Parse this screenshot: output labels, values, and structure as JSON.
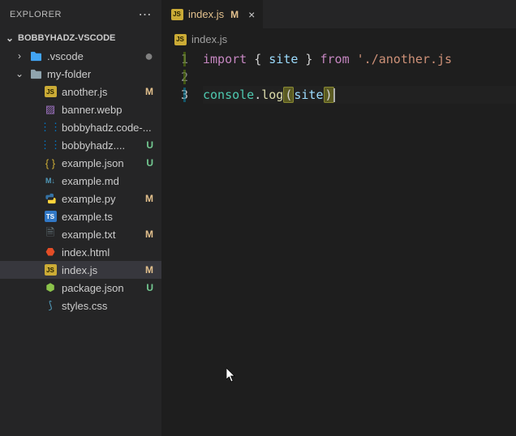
{
  "sidebar": {
    "title": "EXPLORER",
    "project": "BOBBYHADZ-VSCODE",
    "items": [
      {
        "type": "folder",
        "label": ".vscode",
        "indent": 0,
        "icon": "folder-vscode",
        "expanded": false,
        "git": "dot"
      },
      {
        "type": "folder",
        "label": "my-folder",
        "indent": 0,
        "icon": "folder",
        "expanded": true
      },
      {
        "type": "file",
        "label": "another.js",
        "indent": 1,
        "icon": "js",
        "git": "M"
      },
      {
        "type": "file",
        "label": "banner.webp",
        "indent": 1,
        "icon": "image"
      },
      {
        "type": "file",
        "label": "bobbyhadz.code-...",
        "indent": 1,
        "icon": "vscode-ext"
      },
      {
        "type": "file",
        "label": "bobbyhadz....",
        "indent": 1,
        "icon": "vscode-ext",
        "git": "U"
      },
      {
        "type": "file",
        "label": "example.json",
        "indent": 1,
        "icon": "json",
        "git": "U"
      },
      {
        "type": "file",
        "label": "example.md",
        "indent": 1,
        "icon": "md"
      },
      {
        "type": "file",
        "label": "example.py",
        "indent": 1,
        "icon": "py",
        "git": "M"
      },
      {
        "type": "file",
        "label": "example.ts",
        "indent": 1,
        "icon": "ts"
      },
      {
        "type": "file",
        "label": "example.txt",
        "indent": 1,
        "icon": "txt",
        "git": "M"
      },
      {
        "type": "file",
        "label": "index.html",
        "indent": 1,
        "icon": "html"
      },
      {
        "type": "file",
        "label": "index.js",
        "indent": 1,
        "icon": "js",
        "git": "M",
        "active": true
      },
      {
        "type": "file",
        "label": "package.json",
        "indent": 1,
        "icon": "npm",
        "git": "U"
      },
      {
        "type": "file",
        "label": "styles.css",
        "indent": 1,
        "icon": "css"
      }
    ]
  },
  "tab": {
    "filename": "index.js",
    "git": "M",
    "icon": "js"
  },
  "breadcrumb": {
    "filename": "index.js",
    "icon": "js"
  },
  "code": {
    "lines": [
      {
        "n": 1,
        "tokens": [
          [
            "kw",
            "import"
          ],
          [
            "punct",
            " { "
          ],
          [
            "var",
            "site"
          ],
          [
            "punct",
            " } "
          ],
          [
            "kw",
            "from"
          ],
          [
            "punct",
            " "
          ],
          [
            "str",
            "'./another.js"
          ]
        ]
      },
      {
        "n": 2,
        "tokens": []
      },
      {
        "n": 3,
        "current": true,
        "tokens": [
          [
            "obj",
            "console"
          ],
          [
            "punct",
            "."
          ],
          [
            "fn",
            "log"
          ],
          [
            "paren-hl",
            "("
          ],
          [
            "var",
            "site"
          ],
          [
            "paren-hl",
            ")"
          ],
          [
            "cursor",
            ""
          ]
        ]
      }
    ]
  }
}
